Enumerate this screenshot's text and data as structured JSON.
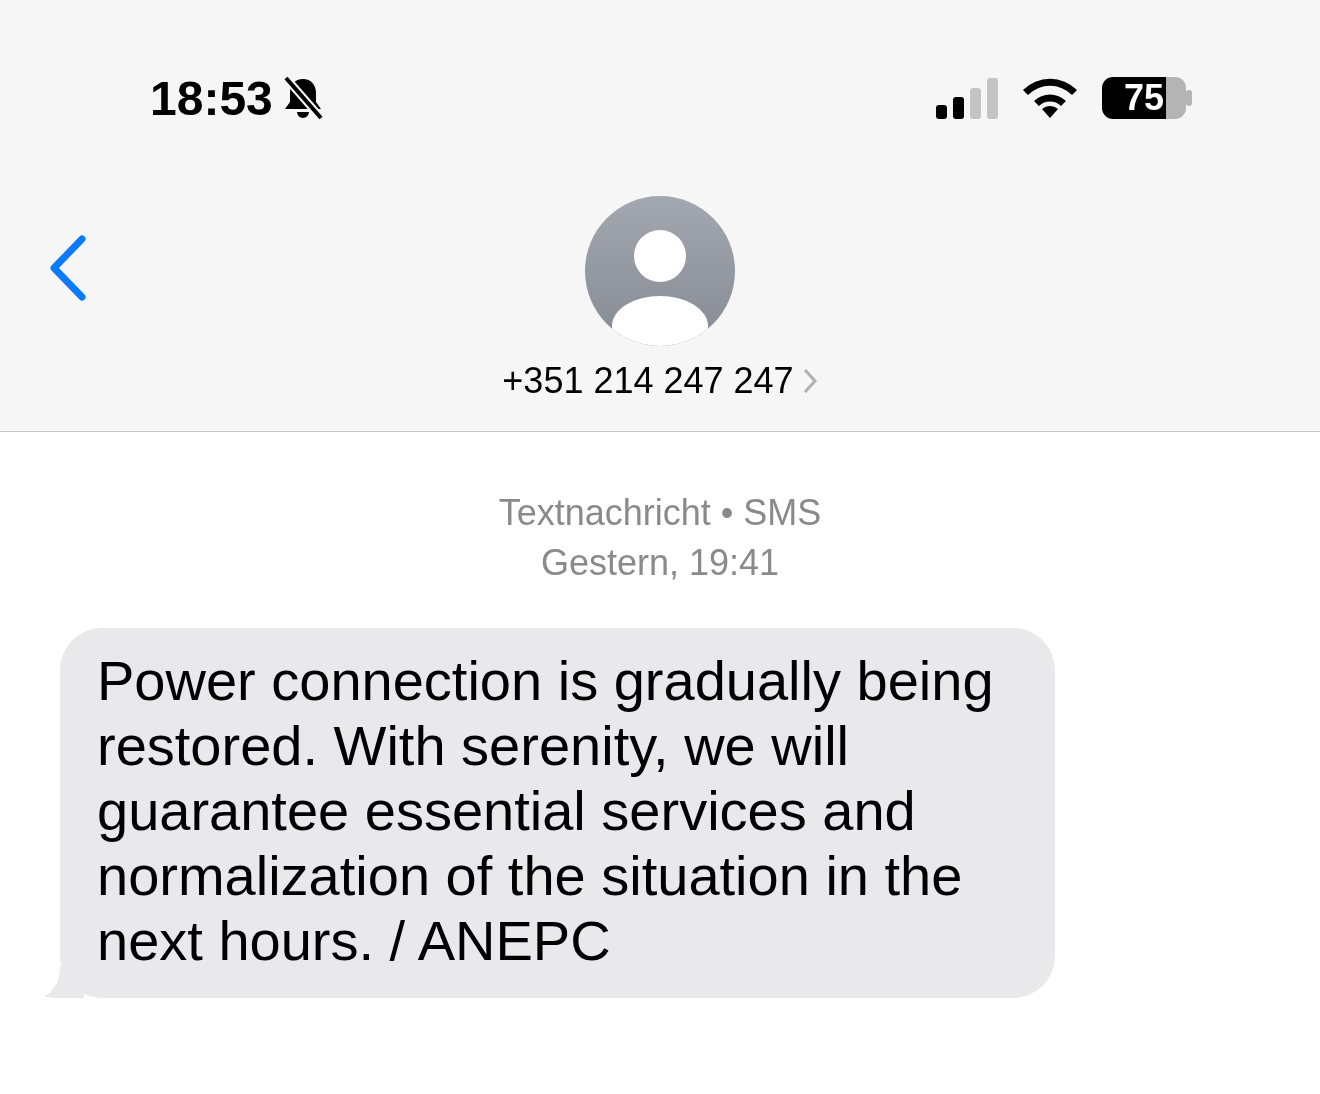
{
  "status_bar": {
    "time": "18:53",
    "battery": "75"
  },
  "header": {
    "contact": "+351 214 247 247"
  },
  "messages": [
    {
      "kind": "meta",
      "service": "Textnachricht • SMS",
      "timestamp": "Gestern, 19:41"
    },
    {
      "kind": "incoming",
      "text": "Power connection is gradually being restored. With serenity, we will guarantee essential services and normalization of the situation in the next hours. / ANEPC"
    }
  ]
}
